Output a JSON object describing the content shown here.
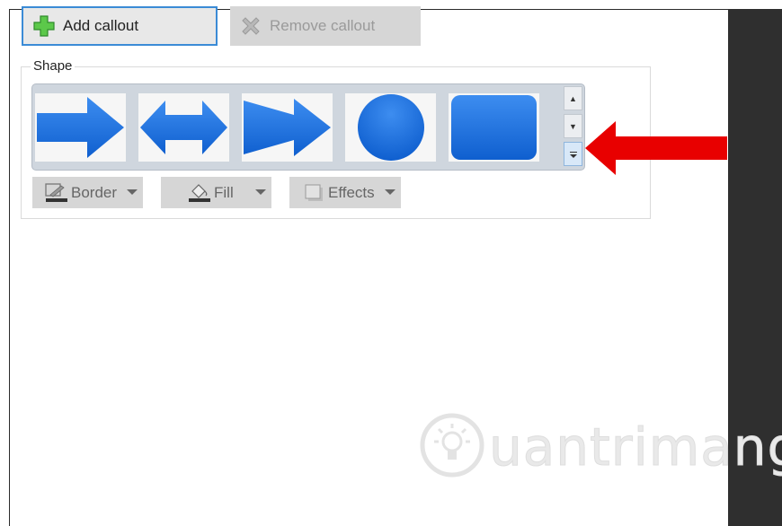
{
  "toolbar": {
    "add_callout": "Add callout",
    "remove_callout": "Remove callout"
  },
  "shape": {
    "legend": "Shape",
    "gallery": [
      {
        "icon": "right-arrow-shape"
      },
      {
        "icon": "left-right-arrow-shape"
      },
      {
        "icon": "chevron-arrow-shape"
      },
      {
        "icon": "circle-shape"
      },
      {
        "icon": "rounded-rectangle-shape"
      }
    ],
    "tools": {
      "border": "Border",
      "fill": "Fill",
      "effects": "Effects"
    }
  },
  "watermark": {
    "text": "uantrimang"
  },
  "colors": {
    "accent": "#3b8bd6",
    "shape_blue": "#1f6fd9",
    "red_arrow": "#e80000",
    "dark_panel": "#2f2f2f"
  }
}
